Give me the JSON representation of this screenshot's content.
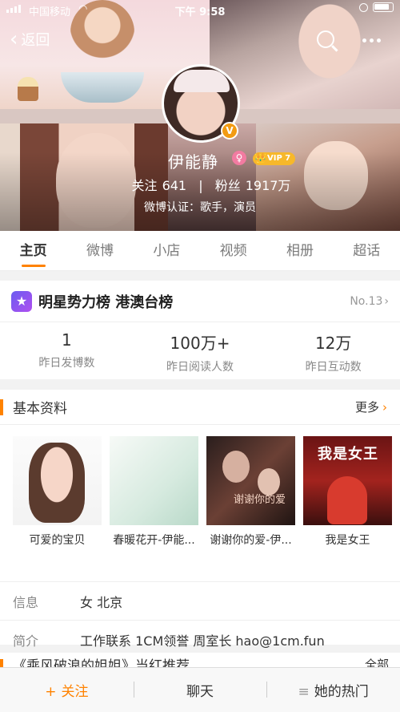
{
  "status_bar": {
    "carrier": "中国移动",
    "time": "下午 9:58"
  },
  "nav": {
    "back_label": "返回"
  },
  "profile": {
    "name": "伊能静",
    "verified_badge": "V",
    "vip_label": "VIP 7",
    "following_label": "关注",
    "following_count": "641",
    "fans_label": "粉丝",
    "fans_count": "1917万",
    "verification": "微博认证：歌手，演员"
  },
  "tabs": [
    {
      "label": "主页",
      "active": true
    },
    {
      "label": "微博"
    },
    {
      "label": "小店"
    },
    {
      "label": "视频"
    },
    {
      "label": "相册"
    },
    {
      "label": "超话"
    }
  ],
  "ranking": {
    "title": "明星势力榜 港澳台榜",
    "rank": "No.13",
    "stats": [
      {
        "value": "1",
        "label": "昨日发博数"
      },
      {
        "value": "100万+",
        "label": "昨日阅读人数"
      },
      {
        "value": "12万",
        "label": "昨日互动数"
      }
    ]
  },
  "basic_info": {
    "title": "基本资料",
    "more_label": "更多",
    "albums": [
      {
        "caption": "可爱的宝贝"
      },
      {
        "caption": "春暖花开-伊能..."
      },
      {
        "caption": "谢谢你的爱-伊..."
      },
      {
        "caption": "我是女王",
        "cover_text": "我是女王"
      }
    ],
    "album3_cover_text": "谢谢你的爱",
    "rows": [
      {
        "key": "信息",
        "value": "女 北京"
      },
      {
        "key": "简介",
        "value": "工作联系 1CM领誉 周室长 hao@1cm.fun"
      }
    ]
  },
  "next_card": {
    "title": "《乘风破浪的姐姐》当红推荐",
    "more_label": "全部"
  },
  "bottom_bar": {
    "follow": "关注",
    "chat": "聊天",
    "hot": "她的热门"
  },
  "colors": {
    "accent": "#ff8200",
    "vip": "#f7b82a",
    "verified": "#f29b13"
  },
  "icons": [
    "back-chevron-icon",
    "search-icon",
    "more-icon",
    "star-rank-icon",
    "chevron-right-icon",
    "plus-icon",
    "menu-lines-icon"
  ]
}
